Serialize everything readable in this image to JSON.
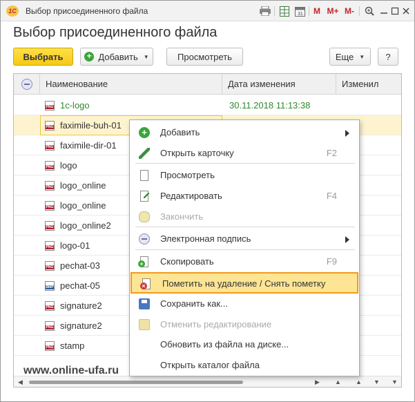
{
  "window": {
    "title": "Выбор присоединенного файла",
    "logo_text": "1С",
    "toolbar_icons": [
      "print-icon",
      "table-icon",
      "calendar-icon",
      "memory-icon",
      "memory-plus-icon",
      "memory-minus-icon",
      "zoom-icon",
      "minimize-icon",
      "maximize-icon",
      "close-icon"
    ],
    "mem_labels": {
      "m": "M",
      "mplus": "M+",
      "mminus": "M-"
    }
  },
  "page_title": "Выбор присоединенного файла",
  "toolbar": {
    "select_label": "Выбрать",
    "add_label": "Добавить",
    "view_label": "Просмотреть",
    "more_label": "Еще",
    "help_label": "?"
  },
  "table": {
    "columns": [
      "Наименование",
      "Дата изменения",
      "Изменил"
    ],
    "rows": [
      {
        "name": "1c-logo",
        "date": "30.11.2018 11:13:38",
        "type": "PNG",
        "highlight": "green"
      },
      {
        "name": "faximile-buh-01",
        "date": "",
        "type": "PNG",
        "highlight": "selected"
      },
      {
        "name": "faximile-dir-01",
        "date": "",
        "type": "PNG"
      },
      {
        "name": "logo",
        "date": "",
        "type": "PNG"
      },
      {
        "name": "logo_online",
        "date": "",
        "type": "PNG"
      },
      {
        "name": "logo_online",
        "date": "",
        "type": "PNG"
      },
      {
        "name": "logo_online2",
        "date": "",
        "type": "PNG"
      },
      {
        "name": "logo-01",
        "date": "",
        "type": "PNG"
      },
      {
        "name": "pechat-03",
        "date": "",
        "type": "PNG"
      },
      {
        "name": "pechat-05",
        "date": "",
        "type": "BMP"
      },
      {
        "name": "signature2",
        "date": "",
        "type": "PNG"
      },
      {
        "name": "signature2",
        "date": "",
        "type": "PNG"
      },
      {
        "name": "stamp",
        "date": "",
        "type": "PNG"
      }
    ]
  },
  "watermark": "www.online-ufa.ru",
  "context_menu": {
    "items": [
      {
        "label": "Добавить",
        "shortcut": "",
        "submenu": true,
        "icon": "add-icon",
        "disabled": false
      },
      {
        "label": "Открыть карточку",
        "shortcut": "F2",
        "submenu": false,
        "icon": "pencil-icon",
        "disabled": false
      },
      {
        "label": "Просмотреть",
        "shortcut": "",
        "submenu": false,
        "icon": "page-icon",
        "disabled": false
      },
      {
        "label": "Редактировать",
        "shortcut": "F4",
        "submenu": false,
        "icon": "edit-icon",
        "disabled": false
      },
      {
        "label": "Закончить",
        "shortcut": "",
        "submenu": false,
        "icon": "finish-icon",
        "disabled": true
      },
      {
        "label": "Электронная подпись",
        "shortcut": "",
        "submenu": true,
        "icon": "signature-icon",
        "disabled": false
      },
      {
        "label": "Скопировать",
        "shortcut": "F9",
        "submenu": false,
        "icon": "copy-icon",
        "disabled": false
      },
      {
        "label": "Пометить на удаление / Снять пометку",
        "shortcut": "",
        "submenu": false,
        "icon": "delete-mark-icon",
        "disabled": false,
        "highlight": true
      },
      {
        "label": "Сохранить как...",
        "shortcut": "",
        "submenu": false,
        "icon": "save-icon",
        "disabled": false
      },
      {
        "label": "Отменить редактирование",
        "shortcut": "",
        "submenu": false,
        "icon": "cancel-edit-icon",
        "disabled": true
      },
      {
        "label": "Обновить из файла на диске...",
        "shortcut": "",
        "submenu": false,
        "icon": "",
        "disabled": false
      },
      {
        "label": "Открыть каталог файла",
        "shortcut": "",
        "submenu": false,
        "icon": "",
        "disabled": false
      }
    ]
  },
  "colors": {
    "primary_button": "#f6c915",
    "highlight_border": "#f29a1b",
    "highlight_bg": "#fde594",
    "green_text": "#2f8a2f",
    "selected_row": "#fdf4cf"
  }
}
